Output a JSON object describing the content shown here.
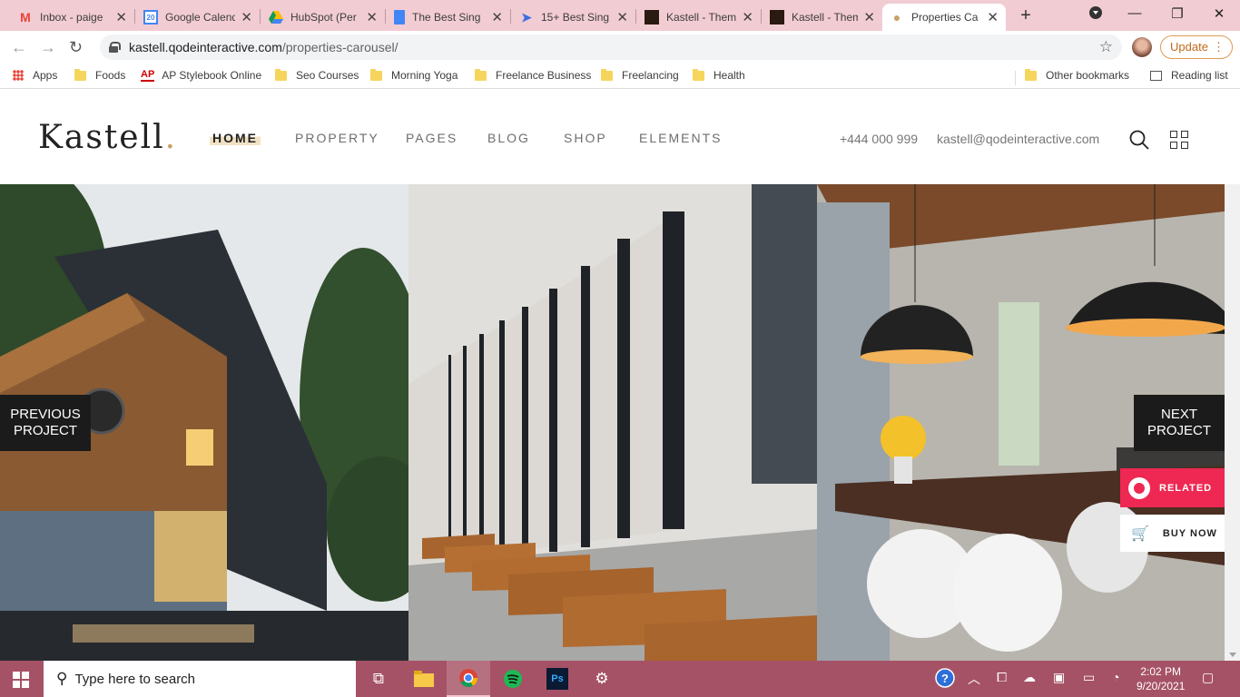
{
  "browser": {
    "tabs": [
      {
        "title": "Inbox - paige",
        "icon": "gmail-icon",
        "active": false
      },
      {
        "title": "Google Calend",
        "icon": "calendar-icon",
        "active": false
      },
      {
        "title": "HubSpot (Per",
        "icon": "drive-icon",
        "active": false
      },
      {
        "title": "The Best Sing",
        "icon": "docs-icon",
        "active": false
      },
      {
        "title": "15+ Best Sing",
        "icon": "send-icon",
        "active": false
      },
      {
        "title": "Kastell - Them",
        "icon": "kastell-icon",
        "active": false
      },
      {
        "title": "Kastell - Them",
        "icon": "kastell-icon",
        "active": false
      },
      {
        "title": "Properties Ca",
        "icon": "location-pin-icon",
        "active": true
      }
    ],
    "url_host": "kastell.qodeinteractive.com",
    "url_path": "/properties-carousel/",
    "update_label": "Update",
    "bookmarks": [
      {
        "label": "Apps",
        "icon": "apps-icon"
      },
      {
        "label": "Foods",
        "icon": "folder-icon"
      },
      {
        "label": "AP Stylebook Online",
        "icon": "ap-icon"
      },
      {
        "label": "Seo Courses",
        "icon": "folder-icon"
      },
      {
        "label": "Morning Yoga",
        "icon": "folder-icon"
      },
      {
        "label": "Freelance Business",
        "icon": "folder-icon"
      },
      {
        "label": "Freelancing",
        "icon": "folder-icon"
      },
      {
        "label": "Health",
        "icon": "folder-icon"
      }
    ],
    "other_bookmarks": "Other bookmarks",
    "reading_list": "Reading list",
    "ap_badge": "AP"
  },
  "site": {
    "logo": "Kastell",
    "logo_dot": ".",
    "menu": [
      "HOME",
      "PROPERTY",
      "PAGES",
      "BLOG",
      "SHOP",
      "ELEMENTS"
    ],
    "phone": "+444 000 999",
    "email": "kastell@qodeinteractive.com",
    "accent_color": "#c8a165"
  },
  "carousel": {
    "prev_line1": "PREVIOUS",
    "prev_line2": "PROJECT",
    "next_line1": "NEXT",
    "next_line2": "PROJECT",
    "related_label": "RELATED",
    "buy_now_label": "BUY NOW",
    "related_color": "#ee2852"
  },
  "taskbar": {
    "search_placeholder": "Type here to search",
    "time": "2:02 PM",
    "date": "9/20/2021",
    "color": "#a65266"
  }
}
